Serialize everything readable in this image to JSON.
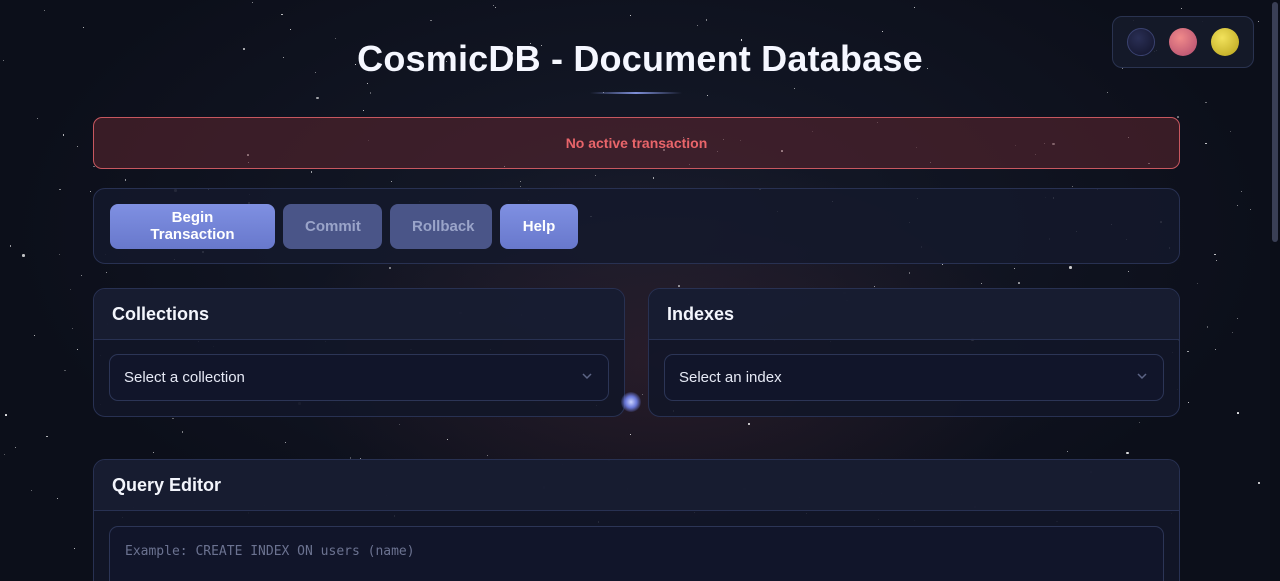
{
  "app": {
    "title": "CosmicDB - Document Database"
  },
  "theme_picker": {
    "themes": [
      {
        "name": "dark",
        "color": "#1b1f3d"
      },
      {
        "name": "rose",
        "color": "#d86a7c"
      },
      {
        "name": "gold",
        "color": "#d9c63a"
      }
    ]
  },
  "status": {
    "message": "No active transaction",
    "color": "#e9656a"
  },
  "toolbar": {
    "begin_label": "Begin Transaction",
    "commit_label": "Commit",
    "rollback_label": "Rollback",
    "help_label": "Help"
  },
  "collections": {
    "heading": "Collections",
    "selected": "Select a collection"
  },
  "indexes": {
    "heading": "Indexes",
    "selected": "Select an index"
  },
  "query_editor": {
    "heading": "Query Editor",
    "placeholder": "Example: CREATE INDEX ON users (name)",
    "value": ""
  },
  "colors": {
    "accent": "#7383d6",
    "background": "#0c0f1a",
    "alert_border": "#c7575f"
  }
}
